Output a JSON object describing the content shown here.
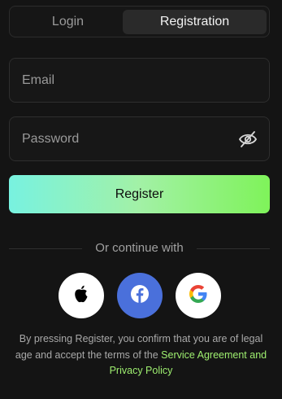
{
  "tabs": {
    "login": "Login",
    "registration": "Registration",
    "active": "registration"
  },
  "form": {
    "email_placeholder": "Email",
    "password_placeholder": "Password",
    "email_value": "",
    "password_value": "",
    "password_toggle_icon": "eye-off-icon"
  },
  "register_label": "Register",
  "divider_text": "Or continue with",
  "social": [
    {
      "name": "apple",
      "icon": "apple-icon"
    },
    {
      "name": "facebook",
      "icon": "facebook-icon"
    },
    {
      "name": "google",
      "icon": "google-icon"
    }
  ],
  "legal": {
    "text": "By pressing Register, you confirm that you are of legal age and accept the terms of the ",
    "link": "Service Agreement and Privacy Policy"
  },
  "colors": {
    "background": "#141414",
    "accent_gradient_start": "#78f2e0",
    "accent_gradient_end": "#7ff35a",
    "link": "#9ff070",
    "facebook": "#4a70db"
  }
}
